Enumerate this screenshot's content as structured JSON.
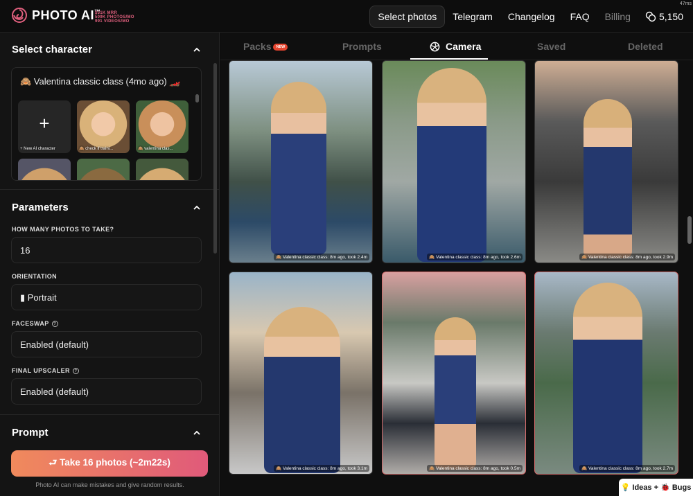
{
  "header": {
    "logo_text": "PHOTO AI",
    "logo_tm": "™",
    "stats": [
      "$51K MRR",
      "509K PHOTOS/MO",
      "991 VIDEOS/MO"
    ],
    "nav": [
      "Select photos",
      "Telegram",
      "Changelog",
      "FAQ",
      "Billing"
    ],
    "credits": "5,150",
    "timer": "47ms"
  },
  "sidebar": {
    "select_character": {
      "title": "Select character",
      "current": "🙈 Valentina classic class (4mo ago) 🏎️",
      "new_label": "+ New AI character",
      "thumbs": [
        "🙈 check if traini...",
        "🙈 valentina clas..."
      ]
    },
    "parameters": {
      "title": "Parameters",
      "photos_label": "HOW MANY PHOTOS TO TAKE?",
      "photos_value": "16",
      "orientation_label": "ORIENTATION",
      "orientation_value": "▮ Portrait",
      "faceswap_label": "FACESWAP",
      "faceswap_value": "Enabled (default)",
      "upscaler_label": "FINAL UPSCALER",
      "upscaler_value": "Enabled (default)"
    },
    "prompt": {
      "title": "Prompt"
    },
    "take_button": "⮐ Take 16 photos (~2m22s)",
    "disclaimer": "Photo AI can make mistakes and give random results."
  },
  "tabs": {
    "packs": "Packs",
    "packs_badge": "NEW",
    "prompts": "Prompts",
    "camera": "Camera",
    "saved": "Saved",
    "deleted": "Deleted"
  },
  "photos": [
    {
      "caption": "🙈 Valentina classic class: 8m ago, took 2.4m"
    },
    {
      "caption": "🙈 Valentina classic class: 8m ago, took 2.6m"
    },
    {
      "caption": "🙈 Valentina classic class: 8m ago, took 2.9m"
    },
    {
      "caption": "🙈 Valentina classic class: 8m ago, took 3.1m"
    },
    {
      "caption": "🙈 Valentina classic class: 8m ago, took 0.5m"
    },
    {
      "caption": "🙈 Valentina classic class: 8m ago, took 2.7m"
    }
  ],
  "feedback": "💡 Ideas + 🐞 Bugs"
}
